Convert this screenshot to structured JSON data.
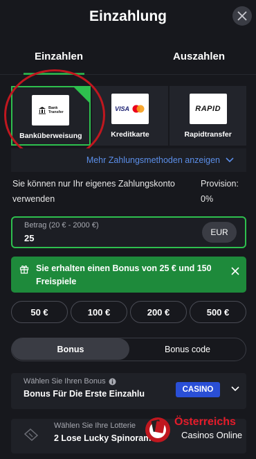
{
  "header": {
    "title": "Einzahlung"
  },
  "tabs": [
    {
      "label": "Einzahlen",
      "active": true
    },
    {
      "label": "Auszahlen",
      "active": false
    }
  ],
  "payment_methods": [
    {
      "label": "Banküberweisung",
      "logo_text_1": "Bank",
      "logo_text_2": "Transfer",
      "selected": true
    },
    {
      "label": "Kreditkarte",
      "logo_text_1": "VISA",
      "selected": false
    },
    {
      "label": "Rapidtransfer",
      "logo_text_1": "RAPID",
      "selected": false
    }
  ],
  "more_methods": "Mehr Zahlungsmethoden anzeigen",
  "info": {
    "text": "Sie können nur Ihr eigenes Zahlungskonto verwenden",
    "provision_label": "Provision:",
    "provision_value": "0%"
  },
  "amount": {
    "label": "Betrag (20 € - 2000 €)",
    "value": "25",
    "currency": "EUR"
  },
  "bonus_banner": {
    "text": "Sie erhalten einen Bonus von 25 € und 150 Freispiele"
  },
  "quick_amounts": [
    "50 €",
    "100 €",
    "200 €",
    "500 €"
  ],
  "bonus_toggle": {
    "active": "Bonus",
    "inactive": "Bonus code"
  },
  "bonus_select": {
    "label": "Wählen Sie Ihren Bonus",
    "value": "Bonus Für Die Erste Einzahlu",
    "badge": "CASINO"
  },
  "lottery_select": {
    "label": "Wählen Sie Ihre Lotterie",
    "value": "2 Lose Lucky Spinorama"
  },
  "watermark": {
    "line1": "Österreichs",
    "line2": "Casinos Online"
  },
  "colors": {
    "accent_green": "#2ec04e",
    "banner_green": "#1e8a3b",
    "link_blue": "#5b8ee8",
    "badge_blue": "#2a4fd6",
    "annotation_red": "#c0171f"
  }
}
